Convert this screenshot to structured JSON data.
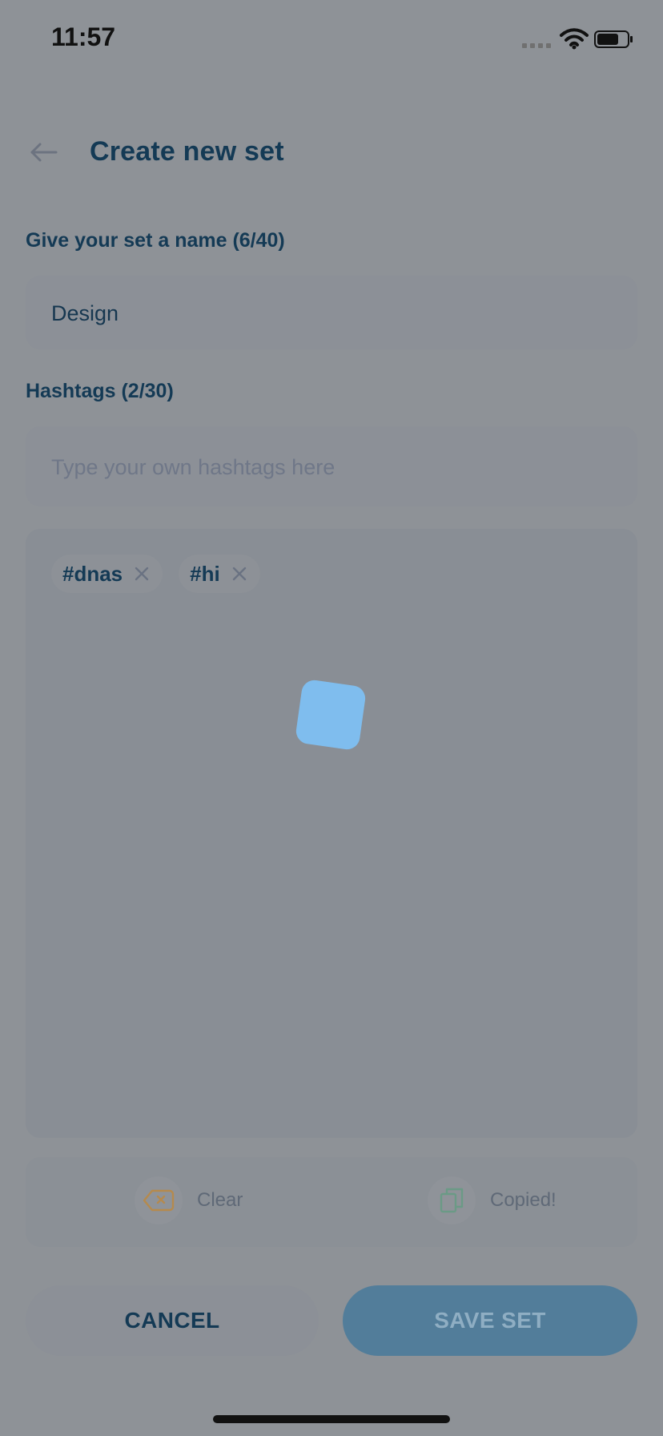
{
  "status_bar": {
    "time": "11:57"
  },
  "header": {
    "title": "Create new set",
    "back_icon": "back-arrow-icon"
  },
  "name_section": {
    "label": "Give your set a name (6/40)",
    "value": "Design"
  },
  "hashtags_section": {
    "label": "Hashtags (2/30)",
    "placeholder": "Type your own hashtags here",
    "tags": [
      {
        "text": "#dnas"
      },
      {
        "text": "#hi"
      }
    ]
  },
  "actions": {
    "clear_label": "Clear",
    "copy_label": "Copied!",
    "cancel_label": "CANCEL",
    "save_label": "SAVE SET"
  },
  "colors": {
    "accent": "#7ec0f2",
    "title": "#143a55",
    "save_button": "#527d9a",
    "overlay_bg": "#8e9297"
  }
}
